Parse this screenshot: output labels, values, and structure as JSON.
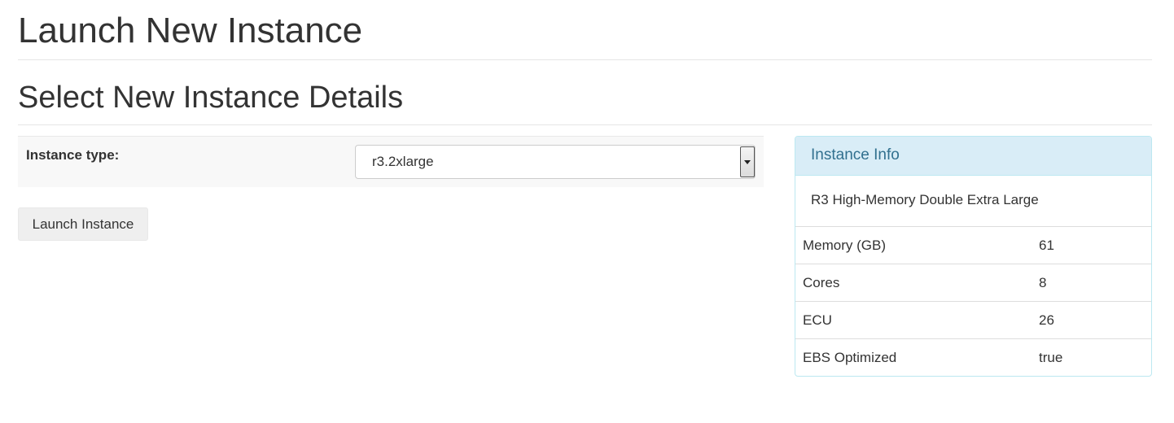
{
  "page": {
    "title": "Launch New Instance",
    "subtitle": "Select New Instance Details"
  },
  "form": {
    "instance_type_label": "Instance type:",
    "instance_type_value": "r3.2xlarge",
    "launch_button_label": "Launch Instance"
  },
  "panel": {
    "title": "Instance Info",
    "description": "R3 High-Memory Double Extra Large",
    "rows": [
      {
        "key": "Memory (GB)",
        "value": "61"
      },
      {
        "key": "Cores",
        "value": "8"
      },
      {
        "key": "ECU",
        "value": "26"
      },
      {
        "key": "EBS Optimized",
        "value": "true"
      }
    ]
  },
  "colors": {
    "panel_heading_bg": "#d9edf7",
    "panel_title_text": "#31708f",
    "panel_border": "#bce8f1"
  }
}
